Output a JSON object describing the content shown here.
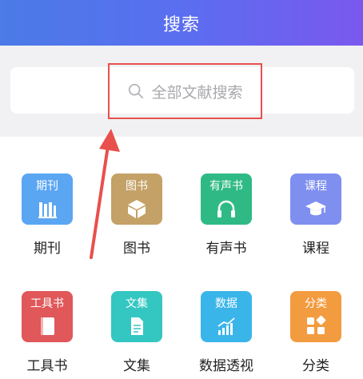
{
  "header": {
    "title": "搜索"
  },
  "search": {
    "placeholder": "全部文献搜索"
  },
  "categories": [
    {
      "tile_label": "期刊",
      "caption": "期刊",
      "color": "#5aa6f3",
      "icon": "books-icon"
    },
    {
      "tile_label": "图书",
      "caption": "图书",
      "color": "#c4a166",
      "icon": "box-icon"
    },
    {
      "tile_label": "有声书",
      "caption": "有声书",
      "color": "#2fba85",
      "icon": "headphones-icon"
    },
    {
      "tile_label": "课程",
      "caption": "课程",
      "color": "#7f8ff0",
      "icon": "graduation-cap-icon"
    },
    {
      "tile_label": "工具书",
      "caption": "工具书",
      "color": "#e0585a",
      "icon": "book-icon"
    },
    {
      "tile_label": "文集",
      "caption": "文集",
      "color": "#34c7c1",
      "icon": "document-icon"
    },
    {
      "tile_label": "数据",
      "caption": "数据透视",
      "color": "#3ab5ea",
      "icon": "bar-chart-icon"
    },
    {
      "tile_label": "分类",
      "caption": "分类",
      "color": "#f39b3f",
      "icon": "category-icon"
    }
  ],
  "accent": "#e8504c"
}
